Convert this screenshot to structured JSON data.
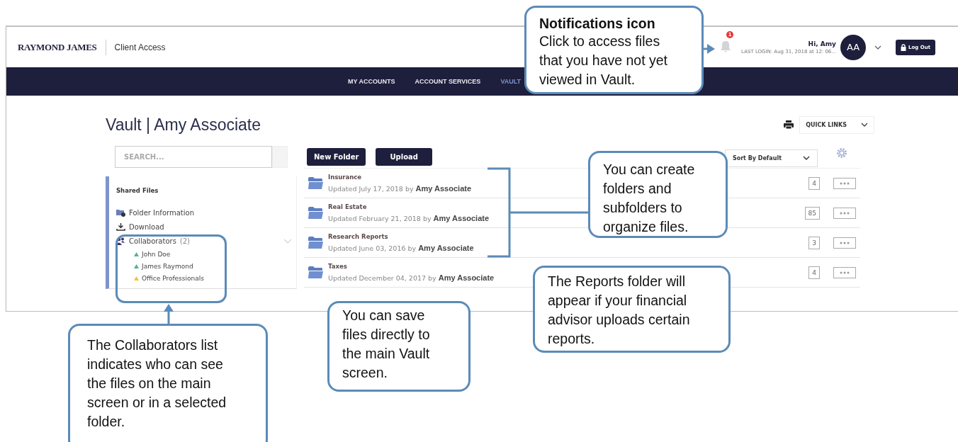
{
  "header": {
    "logo": "RAYMOND JAMES",
    "app_name": "Client Access",
    "notification_count": "1",
    "greeting": "Hi, Amy",
    "last_login": "LAST LOGIN: Aug 31, 2018 at 12: 06...",
    "avatar": "AA",
    "logout": "Log Out"
  },
  "nav": [
    {
      "label": "MY ACCOUNTS",
      "selected": false
    },
    {
      "label": "ACCOUNT SERVICES",
      "selected": false
    },
    {
      "label": "VAULT",
      "selected": true
    }
  ],
  "page_title": "Vault | Amy Associate",
  "quick_links": "QUICK LINKS",
  "sidebar": {
    "search_placeholder": "SEARCH...",
    "section": "Shared Files",
    "actions": [
      {
        "kind": "folder-info",
        "label": "Folder Information"
      },
      {
        "kind": "download",
        "label": "Download"
      }
    ],
    "collaborators": {
      "label": "Collaborators",
      "count": "(2)",
      "members": [
        {
          "name": "John Doe",
          "color": "#5cb08a"
        },
        {
          "name": "James Raymond",
          "color": "#5cb08a"
        },
        {
          "name": "Office Professionals",
          "color": "#f0c04a"
        }
      ]
    }
  },
  "toolbar": {
    "buttons": [
      "New Folder",
      "Upload"
    ],
    "sort": "Sort By Default"
  },
  "folders": [
    {
      "name": "Insurance",
      "updated": "Updated July 17, 2018 by",
      "owner": "Amy Associate",
      "count": "4"
    },
    {
      "name": "Real Estate",
      "updated": "Updated February 21, 2018 by",
      "owner": "Amy Associate",
      "count": "85"
    },
    {
      "name": "Research Reports",
      "updated": "Updated June 03, 2016 by",
      "owner": "Amy Associate",
      "count": "3"
    },
    {
      "name": "Taxes",
      "updated": "Updated December 04, 2017 by",
      "owner": "Amy Associate",
      "count": "4"
    }
  ],
  "callouts": [
    {
      "kind": "notifications",
      "title": "Notifications icon",
      "text": "Click to access files that you have not yet viewed in Vault."
    },
    {
      "kind": "folders",
      "text": "You can create folders and subfolders to organize files."
    },
    {
      "kind": "reports",
      "text": "The Reports folder will appear if your financial advisor uploads certain reports."
    },
    {
      "kind": "save",
      "text": "You can save files directly to the main Vault screen."
    },
    {
      "kind": "collaborators",
      "text": "The Collaborators list indicates who can see the files on the main screen or in a selected folder."
    }
  ]
}
